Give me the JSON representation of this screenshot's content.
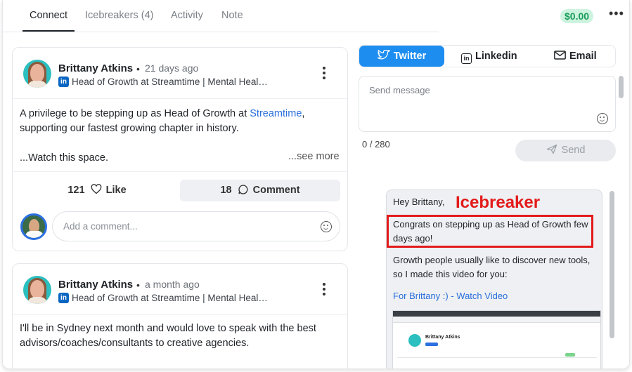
{
  "tabs": [
    {
      "label": "Connect"
    },
    {
      "label": "Icebreakers (4)"
    },
    {
      "label": "Activity"
    },
    {
      "label": "Note"
    }
  ],
  "credit": "$0.00",
  "posts": [
    {
      "author": "Brittany Atkins",
      "time": "21 days ago",
      "headline": "Head of Growth at Streamtime | Mental Heal…",
      "body_before_link": "A privilege to be stepping up as Head of Growth at ",
      "body_link": "Streamtime",
      "body_after_link": ",",
      "body_line2": "supporting our fastest growing chapter in history.",
      "body_line3": "...Watch this space.",
      "see_more": "...see more",
      "likes": "121",
      "like_label": "Like",
      "comments": "18",
      "comment_label": "Comment",
      "comment_placeholder": "Add a comment..."
    },
    {
      "author": "Brittany Atkins",
      "time": "a month ago",
      "headline": "Head of Growth at Streamtime | Mental Heal…",
      "body_line1": "I'll be in Sydney next month and would love to speak with the best",
      "body_line2": "advisors/coaches/consultants to creative agencies."
    }
  ],
  "channels": [
    {
      "label": "Twitter",
      "icon": "twitter-icon"
    },
    {
      "label": "Linkedin",
      "icon": "linkedin-icon"
    },
    {
      "label": "Email",
      "icon": "mail-icon"
    }
  ],
  "message": {
    "placeholder": "Send message",
    "counter": "0 / 280",
    "send_label": "Send"
  },
  "icebreaker": {
    "annotation": "Icebreaker",
    "greeting": "Hey Brittany,",
    "line1": "Congrats on stepping up as Head of Growth few",
    "line2": "days ago!",
    "line3": "Growth people usually like to discover new tools,",
    "line4": "so I made this video for you:",
    "video_link": "For Brittany :) - Watch Video",
    "thumb_name": "Brittany Atkins"
  },
  "colors": {
    "accent": "#1d8ef0",
    "credit_bg": "#cdf3df",
    "credit_text": "#1a9c5b",
    "annotation": "#e31b1b",
    "linkedin": "#0a66c2"
  }
}
